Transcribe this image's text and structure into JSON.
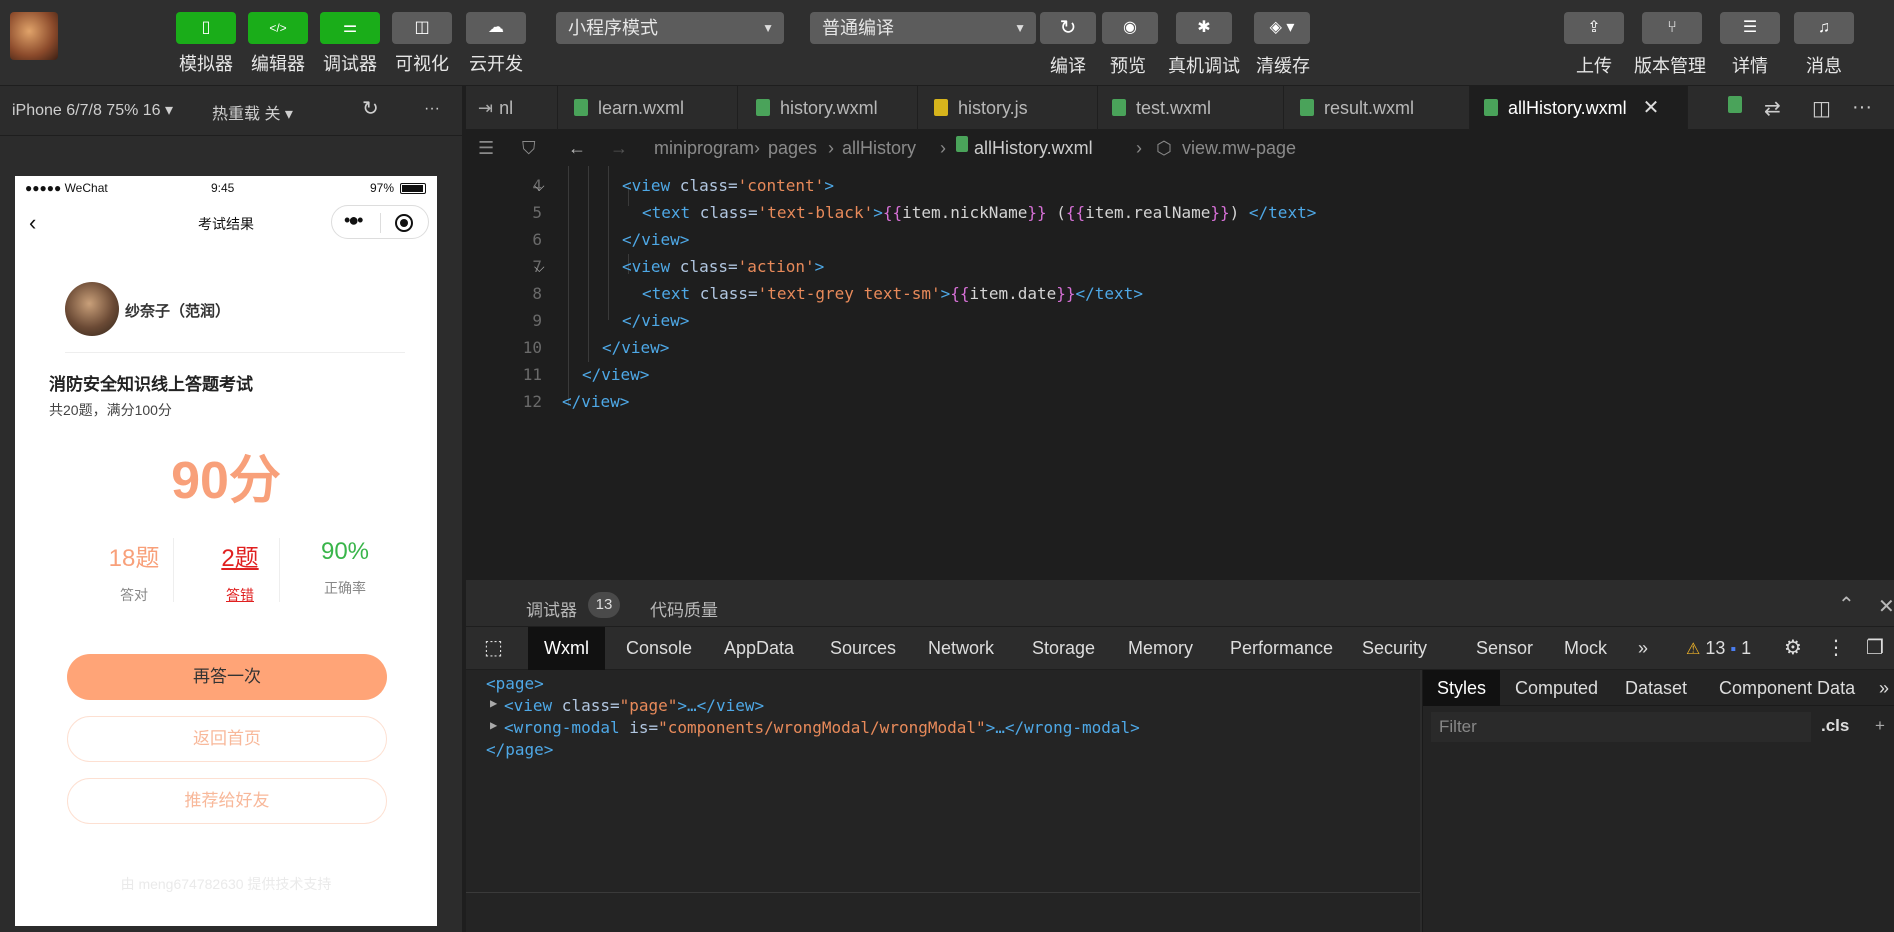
{
  "toolbar": {
    "left_buttons": [
      {
        "label": "模拟器",
        "icon": "phone-icon"
      },
      {
        "label": "编辑器",
        "icon": "code-icon"
      },
      {
        "label": "调试器",
        "icon": "sliders-icon"
      },
      {
        "label": "可视化",
        "icon": "layout-icon"
      },
      {
        "label": "云开发",
        "icon": "cloud-icon"
      }
    ],
    "mode_select": "小程序模式",
    "compile_select": "普通编译",
    "mid_actions": [
      {
        "label": "编译",
        "icon": "refresh-icon"
      },
      {
        "label": "预览",
        "icon": "eye-icon"
      },
      {
        "label": "真机调试",
        "icon": "bug-icon"
      },
      {
        "label": "清缓存",
        "icon": "layers-icon"
      }
    ],
    "right_actions": [
      {
        "label": "上传",
        "icon": "upload-icon"
      },
      {
        "label": "版本管理",
        "icon": "branch-icon"
      },
      {
        "label": "详情",
        "icon": "menu-icon"
      },
      {
        "label": "消息",
        "icon": "bell-icon"
      }
    ]
  },
  "simulator_bar": {
    "device": "iPhone 6/7/8 75% 16 ▾",
    "hot_reload": "热重载 关 ▾",
    "more": "···"
  },
  "phone": {
    "status": {
      "carrier": "●●●●● WeChat",
      "time": "9:45",
      "battery": "97%"
    },
    "nav_title": "考试结果",
    "user_name": "纱奈子（范润）",
    "exam_title": "消防安全知识线上答题考试",
    "exam_sub": "共20题，满分100分",
    "score": "90分",
    "stats": [
      {
        "value": "18题",
        "caption": "答对"
      },
      {
        "value": "2题",
        "caption": "答错"
      },
      {
        "value": "90%",
        "caption": "正确率"
      }
    ],
    "btn_retry": "再答一次",
    "btn_home": "返回首页",
    "btn_share": "推荐给好友",
    "footer": "由 meng674782630 提供技术支持"
  },
  "tabs": [
    {
      "label": "nl",
      "type": "other"
    },
    {
      "label": "learn.wxml",
      "type": "wxml"
    },
    {
      "label": "history.wxml",
      "type": "wxml"
    },
    {
      "label": "history.js",
      "type": "js"
    },
    {
      "label": "test.wxml",
      "type": "wxml"
    },
    {
      "label": "result.wxml",
      "type": "wxml"
    },
    {
      "label": "allHistory.wxml",
      "type": "wxml",
      "active": true
    }
  ],
  "breadcrumb": [
    "miniprogram",
    "pages",
    "allHistory",
    "allHistory.wxml",
    "view.mw-page"
  ],
  "code_lines": {
    "numbers": [
      "4",
      "5",
      "6",
      "7",
      "8",
      "9",
      "10",
      "11",
      "12"
    ],
    "l4": {
      "tag": "<view",
      "attr": " class=",
      "str": "'content'",
      "end": ">"
    },
    "l5": {
      "tag": "<text",
      "attr": " class=",
      "str": "'text-black'",
      "gt": ">",
      "m1": "{{",
      "v1": "item.nickName",
      "m2": "}}",
      "mid": " (",
      "m3": "{{",
      "v2": "item.realName",
      "m4": "}}",
      "close": ") ",
      "endtag": "</text>"
    },
    "l6": "</view>",
    "l7": {
      "tag": "<view",
      "attr": " class=",
      "str": "'action'",
      "end": ">"
    },
    "l8": {
      "tag": "<text",
      "attr": " class=",
      "str": "'text-grey text-sm'",
      "gt": ">",
      "m1": "{{",
      "v1": "item.date",
      "m2": "}}",
      "endtag": "</text>"
    },
    "l9": "</view>",
    "l10": "</view>",
    "l11": "</view>",
    "l12": "</view>"
  },
  "debugger": {
    "label": "调试器",
    "count": "13",
    "quality": "代码质量",
    "tabs": [
      "Wxml",
      "Console",
      "AppData",
      "Sources",
      "Network",
      "Storage",
      "Memory",
      "Performance",
      "Security",
      "Sensor",
      "Mock",
      "»"
    ],
    "warn_count": "13",
    "info_count": "1"
  },
  "dom_tree": {
    "page_open": "<page>",
    "view_tag": "<view",
    "view_attr": " class=",
    "view_val": "\"page\"",
    "view_rest": ">…</view>",
    "modal_tag": "<wrong-modal",
    "modal_attr": " is=",
    "modal_val": "\"components/wrongModal/wrongModal\"",
    "modal_rest": ">…</wrong-modal>",
    "page_close": "</page>"
  },
  "styles_panel": {
    "tabs": [
      "Styles",
      "Computed",
      "Dataset",
      "Component Data",
      "»"
    ],
    "filter_placeholder": "Filter",
    "cls": ".cls",
    "plus": "+"
  },
  "colors": {
    "accent_green": "#1aad19",
    "score_orange": "#f8a07a",
    "wrong_red": "#e02020",
    "rate_green": "#39b54a"
  }
}
